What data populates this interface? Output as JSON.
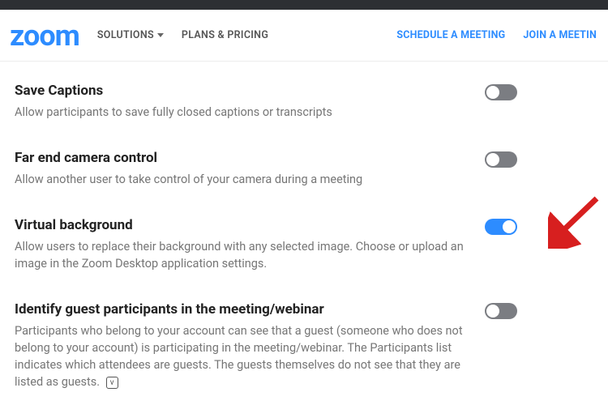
{
  "header": {
    "logo_text": "zoom",
    "nav_solutions": "SOLUTIONS",
    "nav_plans": "PLANS & PRICING",
    "link_schedule": "SCHEDULE A MEETING",
    "link_join": "JOIN A MEETIN"
  },
  "settings": [
    {
      "title": "Save Captions",
      "desc": "Allow participants to save fully closed captions or transcripts",
      "on": false
    },
    {
      "title": "Far end camera control",
      "desc": "Allow another user to take control of your camera during a meeting",
      "on": false
    },
    {
      "title": "Virtual background",
      "desc": "Allow users to replace their background with any selected image. Choose or upload an image in the Zoom Desktop application settings.",
      "on": true
    },
    {
      "title": "Identify guest participants in the meeting/webinar",
      "desc": "Participants who belong to your account can see that a guest (someone who does not belong to your account) is participating in the meeting/webinar. The Participants list indicates which attendees are guests. The guests themselves do not see that they are listed as guests.",
      "on": false,
      "info": true
    }
  ],
  "annotation": {
    "type": "arrow",
    "target": "virtual-background-toggle"
  }
}
